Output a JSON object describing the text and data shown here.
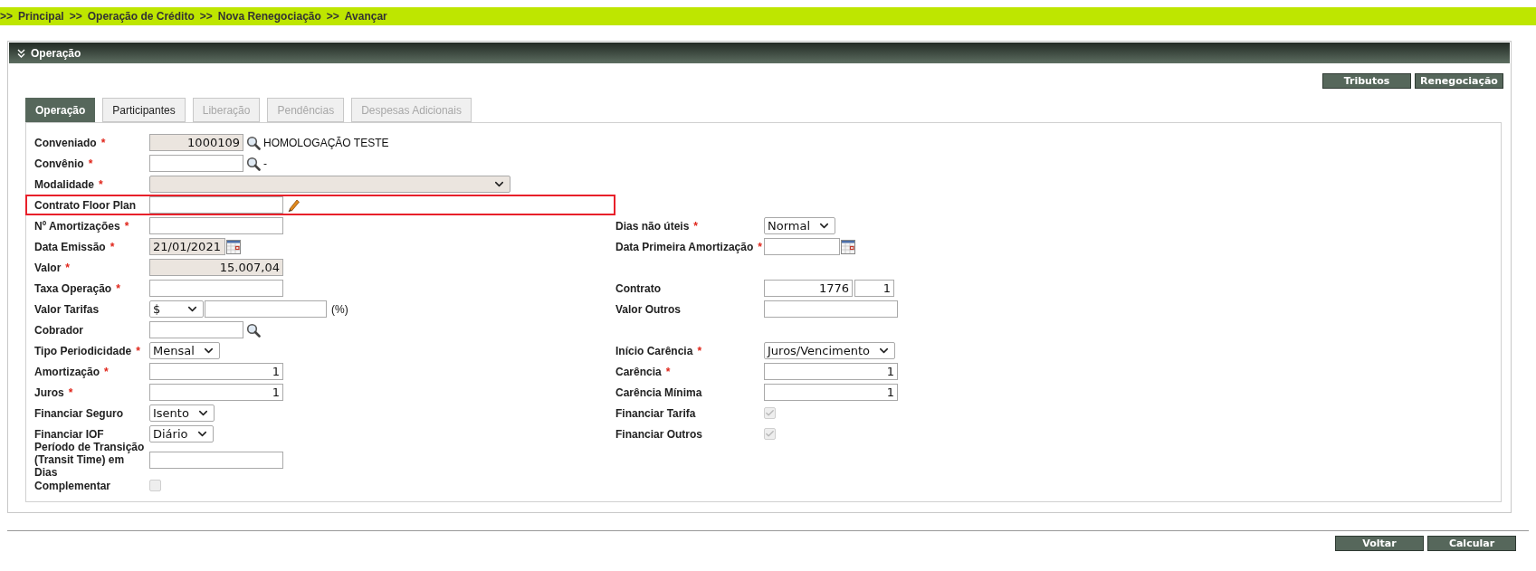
{
  "breadcrumb": {
    "separator": ">>",
    "items": [
      "Principal",
      "Operação de Crédito",
      "Nova Renegociação",
      "Avançar"
    ]
  },
  "panel": {
    "title": "Operação",
    "actions": [
      "Tributos",
      "Renegociação"
    ],
    "tabs": [
      {
        "label": "Operação",
        "selected": true,
        "disabled": false
      },
      {
        "label": "Participantes",
        "selected": false,
        "disabled": false
      },
      {
        "label": "Liberação",
        "selected": false,
        "disabled": true
      },
      {
        "label": "Pendências",
        "selected": false,
        "disabled": true
      },
      {
        "label": "Despesas Adicionais",
        "selected": false,
        "disabled": true
      }
    ],
    "required_marker": "*",
    "rows": [
      {
        "left": {
          "label": "Conveniado",
          "required": true,
          "kind": "lookup",
          "value": "1000109",
          "readonly": true,
          "description": "HOMOLOGAÇÃO TESTE"
        }
      },
      {
        "left": {
          "label": "Convênio",
          "required": true,
          "kind": "lookup",
          "readonly": false,
          "description": "-"
        }
      },
      {
        "left": {
          "label": "Modalidade",
          "required": true,
          "kind": "wide_select",
          "readonly": true
        }
      },
      {
        "left": {
          "label": "Contrato Floor Plan",
          "required": false,
          "kind": "edit",
          "readonly": false,
          "highlighted": true
        }
      },
      {
        "left": {
          "label": "Nº Amortizações",
          "required": true,
          "kind": "text",
          "readonly": false
        },
        "right": {
          "label": "Dias não úteis",
          "required": true,
          "kind": "select",
          "value": "Normal"
        }
      },
      {
        "left": {
          "label": "Data Emissão",
          "required": true,
          "kind": "date",
          "value": "21/01/2021",
          "readonly": true
        },
        "right": {
          "label": "Data Primeira Amortização",
          "required": true,
          "kind": "date",
          "readonly": false
        }
      },
      {
        "left": {
          "label": "Valor",
          "required": true,
          "kind": "text",
          "value": "15.007,04",
          "readonly": true
        }
      },
      {
        "left": {
          "label": "Taxa Operação",
          "required": true,
          "kind": "text",
          "readonly": false
        },
        "right": {
          "label": "Contrato",
          "required": false,
          "kind": "pair",
          "values": [
            "1776",
            "1"
          ]
        }
      },
      {
        "left": {
          "label": "Valor Tarifas",
          "required": false,
          "kind": "currency",
          "value": "$",
          "suffix": "(%)"
        },
        "right": {
          "label": "Valor Outros",
          "required": false,
          "kind": "text",
          "readonly": false
        }
      },
      {
        "left": {
          "label": "Cobrador",
          "required": false,
          "kind": "lookup",
          "readonly": false
        }
      },
      {
        "left": {
          "label": "Tipo Periodicidade",
          "required": true,
          "kind": "select",
          "value": "Mensal"
        },
        "right": {
          "label": "Início Carência",
          "required": true,
          "kind": "select",
          "value": "Juros/Vencimento"
        }
      },
      {
        "left": {
          "label": "Amortização",
          "required": true,
          "kind": "text",
          "value": "1",
          "readonly": false
        },
        "right": {
          "label": "Carência",
          "required": true,
          "kind": "text",
          "value": "1",
          "readonly": false
        }
      },
      {
        "left": {
          "label": "Juros",
          "required": true,
          "kind": "text",
          "value": "1",
          "readonly": false
        },
        "right": {
          "label": "Carência Mínima",
          "required": false,
          "kind": "text",
          "value": "1",
          "readonly": false
        }
      },
      {
        "left": {
          "label": "Financiar Seguro",
          "required": false,
          "kind": "select",
          "value": "Isento"
        },
        "right": {
          "label": "Financiar Tarifa",
          "required": false,
          "kind": "checkbox",
          "checked": true,
          "disabled": true
        }
      },
      {
        "left": {
          "label": "Financiar IOF",
          "required": false,
          "kind": "select",
          "value": "Diário"
        },
        "right": {
          "label": "Financiar Outros",
          "required": false,
          "kind": "checkbox",
          "checked": true,
          "disabled": true
        }
      },
      {
        "left": {
          "label": "Período de Transição (Transit Time) em Dias",
          "required": false,
          "kind": "text",
          "readonly": false
        }
      },
      {
        "left": {
          "label": "Complementar",
          "required": false,
          "kind": "checkbox",
          "checked": false,
          "disabled": true
        }
      }
    ]
  },
  "footer": {
    "actions": [
      "Voltar",
      "Calcular"
    ]
  }
}
